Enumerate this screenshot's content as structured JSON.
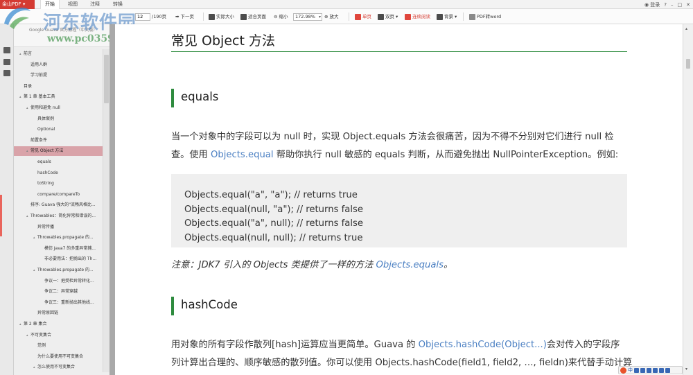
{
  "menubar": {
    "app_name": "金山PDF",
    "tabs": [
      "开始",
      "视图",
      "注释",
      "转换"
    ],
    "active_tab": "开始",
    "login": "登录",
    "controls": [
      "?",
      "–",
      "□",
      "✕"
    ]
  },
  "toolbar": {
    "page_current": "12",
    "page_total": "/190页",
    "next_page": "下一页",
    "actual_size": "实际大小",
    "fit_page": "适合页面",
    "zoom_out": "缩小",
    "zoom_value": "172.98%",
    "zoom_in": "放大",
    "single_page": "单页",
    "double_page": "双页",
    "continuous_read": "连续阅读",
    "background": "背景",
    "pdf_to_word": "PDF转word"
  },
  "outline": {
    "open_tab_title": "Google Guava 官方教程（中文版）",
    "items": [
      {
        "label": "前言",
        "level": 0,
        "arrow": "▴"
      },
      {
        "label": "适用人群",
        "level": 1,
        "arrow": ""
      },
      {
        "label": "学习前提",
        "level": 1,
        "arrow": ""
      },
      {
        "label": "目录",
        "level": 0,
        "arrow": ""
      },
      {
        "label": "第 1 章 基本工具",
        "level": 0,
        "arrow": "▴"
      },
      {
        "label": "使用和避免 null",
        "level": 1,
        "arrow": "▴"
      },
      {
        "label": "具体案例",
        "level": 2,
        "arrow": ""
      },
      {
        "label": "Optional",
        "level": 2,
        "arrow": ""
      },
      {
        "label": "前置条件",
        "level": 1,
        "arrow": ""
      },
      {
        "label": "常见 Object 方法",
        "level": 1,
        "arrow": "▴",
        "selected": true
      },
      {
        "label": "equals",
        "level": 2,
        "arrow": ""
      },
      {
        "label": "hashCode",
        "level": 2,
        "arrow": ""
      },
      {
        "label": "toString",
        "level": 2,
        "arrow": ""
      },
      {
        "label": "compare/compareTo",
        "level": 2,
        "arrow": ""
      },
      {
        "label": "排序: Guava 强大的\"流畅风格比...",
        "level": 1,
        "arrow": ""
      },
      {
        "label": "Throwables：简化异常和错误的...",
        "level": 1,
        "arrow": "▴"
      },
      {
        "label": "异常传播",
        "level": 2,
        "arrow": ""
      },
      {
        "label": "Throwables.propagate 的...",
        "level": 2,
        "arrow": "▴"
      },
      {
        "label": "模仿 Java7 的多重异常捕...",
        "level": 3,
        "arrow": ""
      },
      {
        "label": "非必要用法：把抛出的 Th...",
        "level": 3,
        "arrow": ""
      },
      {
        "label": "Throwables.propagate 的...",
        "level": 2,
        "arrow": "▴"
      },
      {
        "label": "争议一：把受检异常转化...",
        "level": 3,
        "arrow": ""
      },
      {
        "label": "争议二：异常穿越",
        "level": 3,
        "arrow": ""
      },
      {
        "label": "争议三：重新抛出其他线...",
        "level": 3,
        "arrow": ""
      },
      {
        "label": "异常原因链",
        "level": 2,
        "arrow": ""
      },
      {
        "label": "第 2 章 集合",
        "level": 0,
        "arrow": "▴"
      },
      {
        "label": "不可变集合",
        "level": 1,
        "arrow": "▴"
      },
      {
        "label": "范例",
        "level": 2,
        "arrow": ""
      },
      {
        "label": "为什么要使用不可变集合",
        "level": 2,
        "arrow": ""
      },
      {
        "label": "怎么使用不可变集合",
        "level": 2,
        "arrow": "▴"
      }
    ]
  },
  "watermark": {
    "title": "河东软件园",
    "url": "www.pc0359.cn"
  },
  "document": {
    "h1": "常见 Object 方法",
    "sections": [
      {
        "heading": "equals",
        "para_line1": "当一个对象中的字段可以为 null 时，实现 Object.equals 方法会很痛苦，因为不得不分别对它们进行 null 检",
        "para_line2_pre": "查。使用 ",
        "para_line2_link": "Objects.equal",
        "para_line2_post": " 帮助你执行 null 敏感的 equals 判断，从而避免抛出 NullPointerException。例如:",
        "code": [
          "Objects.equal(\"a\", \"a\"); // returns true",
          "Objects.equal(null, \"a\"); // returns false",
          "Objects.equal(\"a\", null); // returns false",
          "Objects.equal(null, null); // returns true"
        ],
        "note_pre": "注意：JDK7 引入的 Objects 类提供了一样的方法 ",
        "note_link": "Objects.equals",
        "note_post": "。"
      },
      {
        "heading": "hashCode",
        "para_line1_pre": "用对象的所有字段作散列[hash]运算应当更简单。Guava 的 ",
        "para_line1_link": "Objects.hashCode(Object...)",
        "para_line1_post": "会对传入的字段序",
        "para_line2": "列计算出合理的、顺序敏感的散列值。你可以使用 Objects.hashCode(field1, field2, …, fieldn)来代替手动计算"
      }
    ]
  },
  "ime": {
    "label": "中"
  }
}
